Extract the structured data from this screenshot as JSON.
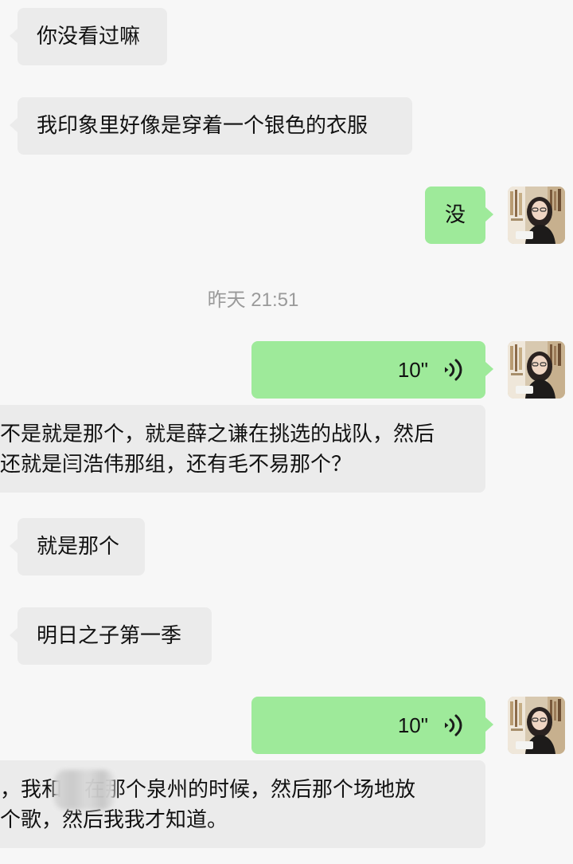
{
  "messages": [
    {
      "id": "m1",
      "direction": "incoming",
      "type": "text",
      "text": "你没看过嘛"
    },
    {
      "id": "m2",
      "direction": "incoming",
      "type": "text",
      "text": "我印象里好像是穿着一个银色的衣服"
    },
    {
      "id": "m3",
      "direction": "outgoing",
      "type": "text",
      "text": "没"
    },
    {
      "id": "m4",
      "direction": "outgoing",
      "type": "voice",
      "duration": "10\""
    },
    {
      "id": "m5",
      "direction": "incoming",
      "type": "text",
      "lines": [
        "不是就是那个，就是薛之谦在挑选的战队，然后",
        "还就是闫浩伟那组，还有毛不易那个？"
      ]
    },
    {
      "id": "m6",
      "direction": "incoming",
      "type": "text",
      "text": "就是那个"
    },
    {
      "id": "m7",
      "direction": "incoming",
      "type": "text",
      "text": "明日之子第一季"
    },
    {
      "id": "m8",
      "direction": "outgoing",
      "type": "voice",
      "duration": "10\""
    },
    {
      "id": "m9",
      "direction": "incoming",
      "type": "text",
      "lines": [
        "，我和",
        "在那个泉州的时候，然后那个场地放",
        "个歌，然后我我才知道。"
      ]
    }
  ],
  "timestamp": "昨天 21:51",
  "colors": {
    "background": "#f7f7f7",
    "incoming_bubble": "#ebebeb",
    "outgoing_bubble": "#9eea9a",
    "text": "#111111",
    "timestamp": "#9a9a9a"
  },
  "icons": {
    "voice": "voice-wave-icon",
    "avatar": "user-avatar"
  }
}
